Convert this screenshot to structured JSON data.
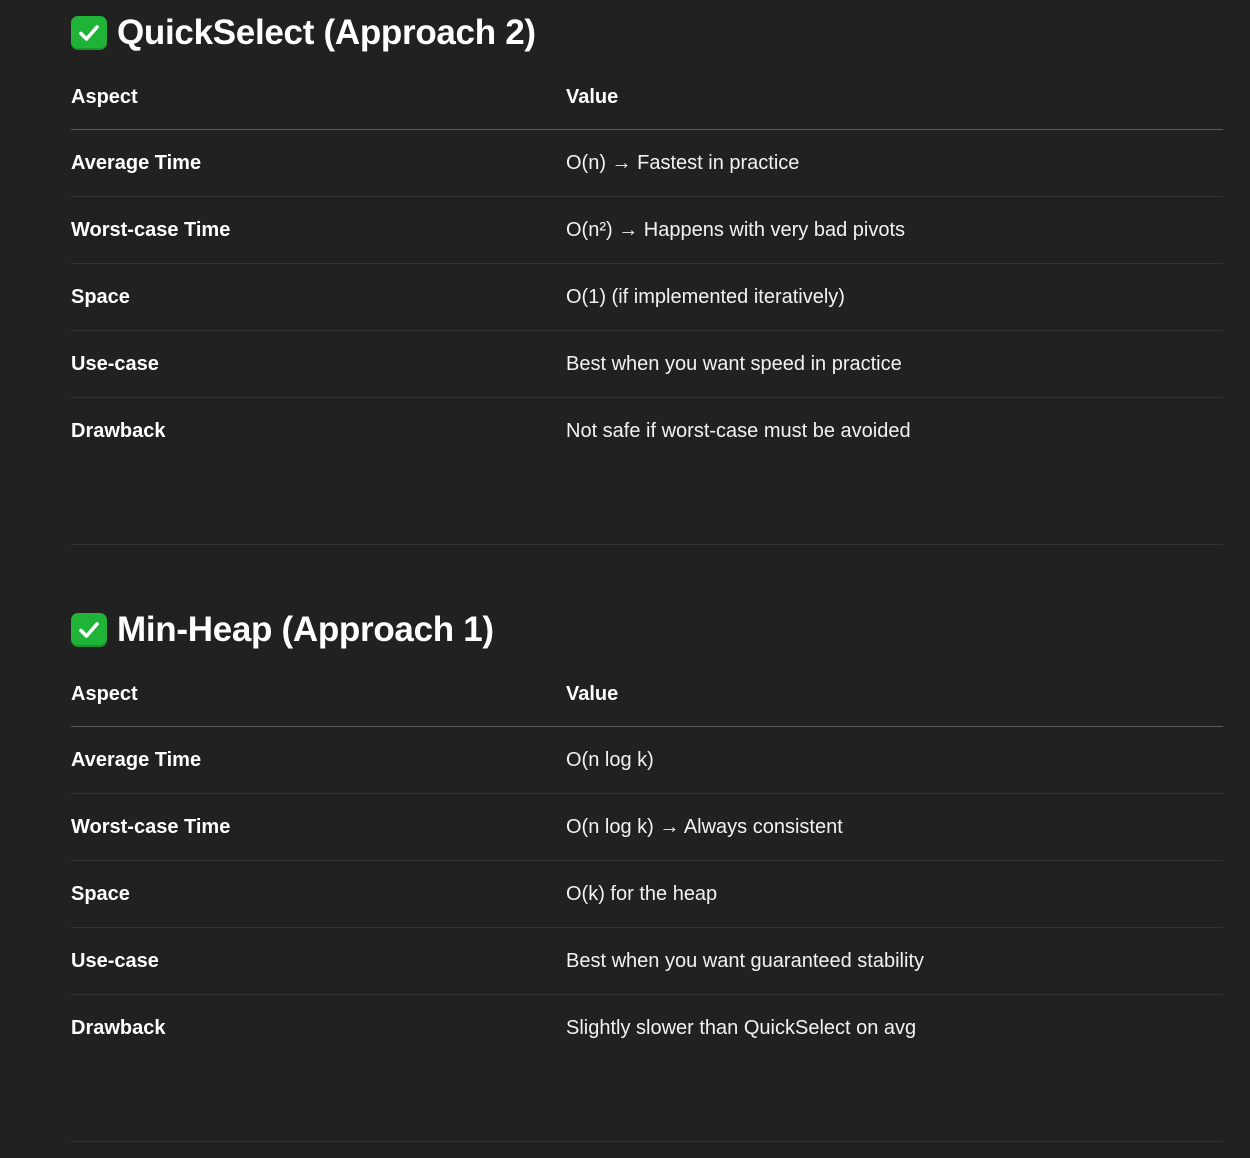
{
  "sections": [
    {
      "heading": "QuickSelect (Approach 2)",
      "icon": "check-mark-button-icon",
      "header": {
        "aspect": "Aspect",
        "value": "Value"
      },
      "rows": [
        {
          "aspect": "Average Time",
          "value": "O(n) → Fastest in practice"
        },
        {
          "aspect": "Worst-case Time",
          "value": "O(n²) → Happens with very bad pivots"
        },
        {
          "aspect": "Space",
          "value": "O(1) (if implemented iteratively)"
        },
        {
          "aspect": "Use-case",
          "value": "Best when you want speed in practice"
        },
        {
          "aspect": "Drawback",
          "value": "Not safe if worst-case must be avoided"
        }
      ]
    },
    {
      "heading": "Min-Heap (Approach 1)",
      "icon": "check-mark-button-icon",
      "header": {
        "aspect": "Aspect",
        "value": "Value"
      },
      "rows": [
        {
          "aspect": "Average Time",
          "value": "O(n log k)"
        },
        {
          "aspect": "Worst-case Time",
          "value": "O(n log k) → Always consistent"
        },
        {
          "aspect": "Space",
          "value": "O(k) for the heap"
        },
        {
          "aspect": "Use-case",
          "value": "Best when you want guaranteed stability"
        },
        {
          "aspect": "Drawback",
          "value": "Slightly slower than QuickSelect on avg"
        }
      ]
    }
  ],
  "colors": {
    "background": "#212121",
    "text": "#ffffff",
    "check_green": "#1fb338",
    "divider": "#333333"
  }
}
